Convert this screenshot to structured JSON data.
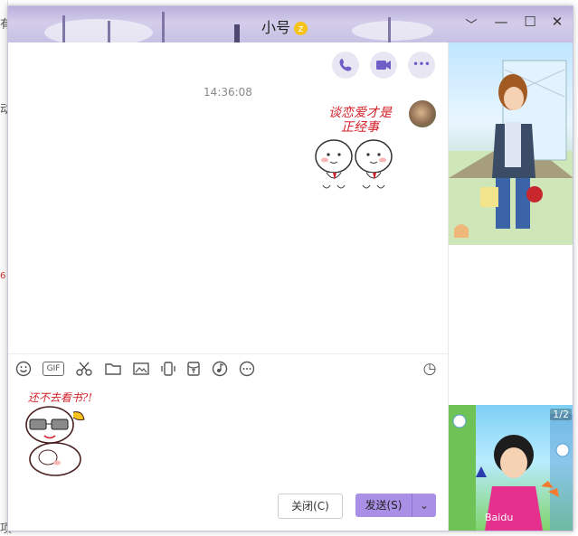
{
  "background_fragments": [
    "有",
    "动",
    "6",
    "项"
  ],
  "window": {
    "title": "小号",
    "badge": "z",
    "controls": {
      "minimize": "﹀",
      "restore": "—",
      "maximize": "☐",
      "close": "✕"
    }
  },
  "chat": {
    "timestamp": "14:36:08",
    "sticker_message": {
      "line1": "谈恋爱才是",
      "line2": "正经事"
    },
    "actions": {
      "voice_call": "✆",
      "video_call": "▶",
      "more": "•••"
    }
  },
  "toolbar": {
    "gif": "GIF",
    "history": "◷"
  },
  "input": {
    "sticker_text": "还不去看书?!"
  },
  "buttons": {
    "close": "关闭(C)",
    "send": "发送(S)",
    "send_dropdown": "⌄"
  },
  "sidebar": {
    "second_page_indicator": "1/2",
    "watermark": "Baidu"
  },
  "colors": {
    "accent": "#a990e6",
    "titlebar": "#c8c1e4",
    "action_icon": "#6f5fc6",
    "sticker_text": "#d3202a"
  },
  "icons": [
    "emoji-icon",
    "gif-icon",
    "scissors-icon",
    "folder-icon",
    "image-icon",
    "shake-icon",
    "red-packet-icon",
    "music-icon",
    "more-icon",
    "history-icon",
    "phone-icon",
    "video-icon"
  ]
}
